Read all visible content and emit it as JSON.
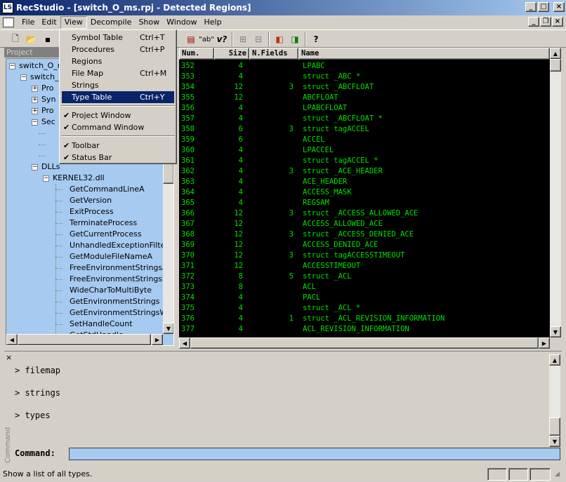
{
  "window": {
    "title": "RecStudio - [switch_O_ms.rpj - Detected Regions]"
  },
  "menubar": [
    "File",
    "Edit",
    "View",
    "Decompile",
    "Show",
    "Window",
    "Help"
  ],
  "view_menu": {
    "items": [
      {
        "label": "Symbol Table",
        "shortcut": "Ctrl+T",
        "checked": false,
        "highlight": false
      },
      {
        "label": "Procedures",
        "shortcut": "Ctrl+P",
        "checked": false,
        "highlight": false
      },
      {
        "label": "Regions",
        "shortcut": "",
        "checked": false,
        "highlight": false
      },
      {
        "label": "File Map",
        "shortcut": "Ctrl+M",
        "checked": false,
        "highlight": false
      },
      {
        "label": "Strings",
        "shortcut": "",
        "checked": false,
        "highlight": false
      },
      {
        "label": "Type Table",
        "shortcut": "Ctrl+Y",
        "checked": false,
        "highlight": true
      },
      {
        "label": "Project Window",
        "shortcut": "",
        "checked": true,
        "highlight": false
      },
      {
        "label": "Command Window",
        "shortcut": "",
        "checked": true,
        "highlight": false
      },
      {
        "label": "Toolbar",
        "shortcut": "",
        "checked": true,
        "highlight": false
      },
      {
        "label": "Status Bar",
        "shortcut": "",
        "checked": true,
        "highlight": false
      }
    ]
  },
  "project": {
    "header": "Project",
    "tree": [
      {
        "label": "switch_O_r",
        "level": 0,
        "box": "-"
      },
      {
        "label": "switch_",
        "level": 1,
        "box": "-"
      },
      {
        "label": "Pro",
        "level": 2,
        "box": "+"
      },
      {
        "label": "Syn",
        "level": 2,
        "box": "+"
      },
      {
        "label": "Pro",
        "level": 2,
        "box": "+"
      },
      {
        "label": "Sec",
        "level": 2,
        "box": "-"
      },
      {
        "label": "",
        "level": 3,
        "box": ""
      },
      {
        "label": "",
        "level": 3,
        "box": ""
      },
      {
        "label": "",
        "level": 3,
        "box": ""
      },
      {
        "label": "DLLs",
        "level": 2,
        "box": "-"
      },
      {
        "label": "KERNEL32.dll",
        "level": 3,
        "box": "-"
      },
      {
        "label": "GetCommandLineA",
        "level": 4,
        "box": ""
      },
      {
        "label": "GetVersion",
        "level": 4,
        "box": ""
      },
      {
        "label": "ExitProcess",
        "level": 4,
        "box": ""
      },
      {
        "label": "TerminateProcess",
        "level": 4,
        "box": ""
      },
      {
        "label": "GetCurrentProcess",
        "level": 4,
        "box": ""
      },
      {
        "label": "UnhandledExceptionFilter",
        "level": 4,
        "box": ""
      },
      {
        "label": "GetModuleFileNameA",
        "level": 4,
        "box": ""
      },
      {
        "label": "FreeEnvironmentStringsA",
        "level": 4,
        "box": ""
      },
      {
        "label": "FreeEnvironmentStringsW",
        "level": 4,
        "box": ""
      },
      {
        "label": "WideCharToMultiByte",
        "level": 4,
        "box": ""
      },
      {
        "label": "GetEnvironmentStrings",
        "level": 4,
        "box": ""
      },
      {
        "label": "GetEnvironmentStringsW",
        "level": 4,
        "box": ""
      },
      {
        "label": "SetHandleCount",
        "level": 4,
        "box": ""
      },
      {
        "label": "GetStdHandle",
        "level": 4,
        "box": ""
      }
    ]
  },
  "table": {
    "columns": [
      "Num.",
      "Size",
      "N.Fields",
      "Name"
    ],
    "rows": [
      [
        "352",
        "4",
        "",
        "LPABC"
      ],
      [
        "353",
        "4",
        "",
        "struct _ABC *"
      ],
      [
        "354",
        "12",
        "3",
        "struct _ABCFLOAT"
      ],
      [
        "355",
        "12",
        "",
        "ABCFLOAT"
      ],
      [
        "356",
        "4",
        "",
        "LPABCFLOAT"
      ],
      [
        "357",
        "4",
        "",
        "struct _ABCFLOAT *"
      ],
      [
        "358",
        "6",
        "3",
        "struct tagACCEL"
      ],
      [
        "359",
        "6",
        "",
        "ACCEL"
      ],
      [
        "360",
        "4",
        "",
        "LPACCEL"
      ],
      [
        "361",
        "4",
        "",
        "struct tagACCEL *"
      ],
      [
        "362",
        "4",
        "3",
        "struct _ACE_HEADER"
      ],
      [
        "363",
        "4",
        "",
        "ACE_HEADER"
      ],
      [
        "364",
        "4",
        "",
        "ACCESS_MASK"
      ],
      [
        "365",
        "4",
        "",
        "REGSAM"
      ],
      [
        "366",
        "12",
        "3",
        "struct _ACCESS_ALLOWED_ACE"
      ],
      [
        "367",
        "12",
        "",
        "ACCESS_ALLOWED_ACE"
      ],
      [
        "368",
        "12",
        "3",
        "struct _ACCESS_DENIED_ACE"
      ],
      [
        "369",
        "12",
        "",
        "ACCESS_DENIED_ACE"
      ],
      [
        "370",
        "12",
        "3",
        "struct tagACCESSTIMEOUT"
      ],
      [
        "371",
        "12",
        "",
        "ACCESSTIMEOUT"
      ],
      [
        "372",
        "8",
        "5",
        "struct _ACL"
      ],
      [
        "373",
        "8",
        "",
        "ACL"
      ],
      [
        "374",
        "4",
        "",
        "PACL"
      ],
      [
        "375",
        "4",
        "",
        "struct _ACL *"
      ],
      [
        "376",
        "4",
        "1",
        "struct _ACL_REVISION_INFORMATION"
      ],
      [
        "377",
        "4",
        "",
        "ACL_REVISION_INFORMATION"
      ]
    ]
  },
  "command": {
    "side_label": "Command",
    "output": [
      "> filemap",
      "> strings",
      "> types"
    ],
    "prompt_label": "Command:",
    "input_value": ""
  },
  "status": {
    "text": "Show a list of all types."
  }
}
